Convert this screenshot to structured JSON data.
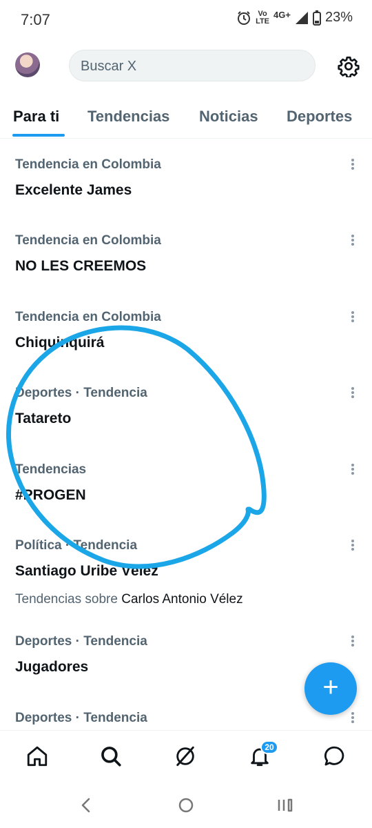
{
  "status_bar": {
    "time": "7:07",
    "network_top": "Vo",
    "network_bottom": "LTE",
    "network_type": "4G+",
    "battery": "23%"
  },
  "header": {
    "search_placeholder": "Buscar X"
  },
  "tabs": [
    {
      "label": "Para ti",
      "active": true
    },
    {
      "label": "Tendencias",
      "active": false
    },
    {
      "label": "Noticias",
      "active": false
    },
    {
      "label": "Deportes",
      "active": false
    }
  ],
  "trends": [
    {
      "context": "Tendencia en Colombia",
      "title": "Excelente James"
    },
    {
      "context": "Tendencia en Colombia",
      "title": "NO LES CREEMOS"
    },
    {
      "context": "Tendencia en Colombia",
      "title": "Chiquinquirá"
    },
    {
      "context": "Deportes · Tendencia",
      "title": "Tatareto"
    },
    {
      "context": "Tendencias",
      "title": "#PROGEN"
    },
    {
      "context": "Política · Tendencia",
      "title": "Santiago Uribe Vélez",
      "sub_prefix": "Tendencias sobre",
      "sub_name": "Carlos Antonio Vélez"
    },
    {
      "context": "Deportes · Tendencia",
      "title": "Jugadores"
    },
    {
      "context": "Deportes · Tendencia",
      "title": ""
    }
  ],
  "notifications_badge": "20",
  "colors": {
    "accent": "#1d9bf0",
    "text_primary": "#0f1419",
    "text_secondary": "#536471",
    "scribble": "#1ba6e8"
  }
}
